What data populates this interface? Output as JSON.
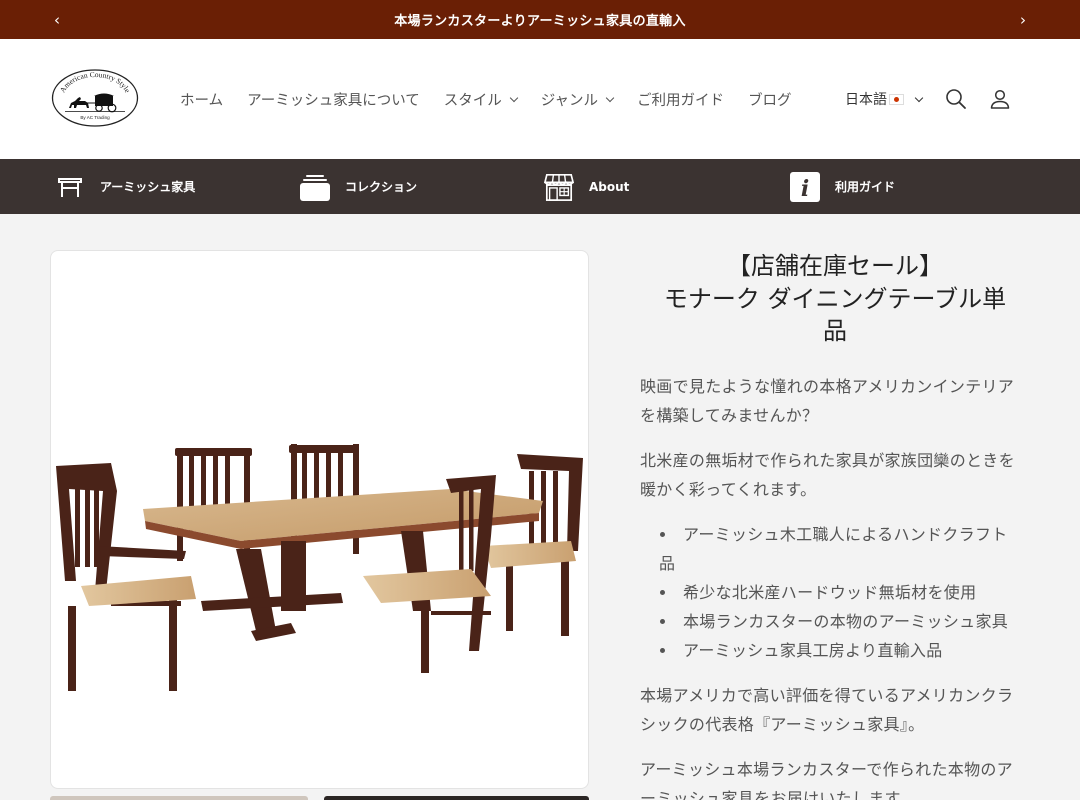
{
  "announcement": {
    "message": "本場ランカスターよりアーミッシュ家具の直輸入",
    "prev": "‹",
    "next": "›"
  },
  "logo": {
    "line1": "American Country Style",
    "line2": "By AC Trading"
  },
  "nav": [
    {
      "label": "ホーム"
    },
    {
      "label": "アーミッシュ家具について"
    },
    {
      "label": "スタイル"
    },
    {
      "label": "ジャンル"
    },
    {
      "label": "ご利用ガイド"
    },
    {
      "label": "ブログ"
    }
  ],
  "language": {
    "label": "日本語"
  },
  "icons": {
    "search": "search-icon",
    "account": "account-icon"
  },
  "categories": [
    {
      "label": "アーミッシュ家具",
      "icon": "furniture-icon"
    },
    {
      "label": "コレクション",
      "icon": "collection-icon"
    },
    {
      "label": "About",
      "icon": "store-icon"
    },
    {
      "label": "利用ガイド",
      "icon": "info-icon"
    }
  ],
  "product": {
    "title_line1": "【店舗在庫セール】",
    "title_line2": "モナーク ダイニングテーブル単",
    "title_line3": "品",
    "para1_line1": "映画で見たような憧れの本格アメリカンインテリア",
    "para1_line2": "を構築してみませんか？",
    "para2_line1": "北米産の無垢材で作られた家具が家族団欒のときを",
    "para2_line2": "暖かく彩ってくれます。",
    "bullets": [
      {
        "line1": "アーミッシュ木工職人によるハンドクラフト",
        "line2": "品"
      },
      {
        "line1": "希少な北米産ハードウッド無垢材を使用"
      },
      {
        "line1": "本場ランカスターの本物のアーミッシュ家具"
      },
      {
        "line1": "アーミッシュ家具工房より直輸入品"
      }
    ],
    "para3_line1": "本場アメリカで高い評価を得ているアメリカンクラ",
    "para3_line2": "シックの代表格『アーミッシュ家具』。",
    "para4_line1": "アーミッシュ本場ランカスターで作られた本物のア",
    "para4_line2": "ーミッシュ家具をお届けいたします。"
  },
  "colors": {
    "announcement_bg": "#6a1f05",
    "category_bar_bg": "#3b3331",
    "page_bg": "#f3f3f3"
  }
}
